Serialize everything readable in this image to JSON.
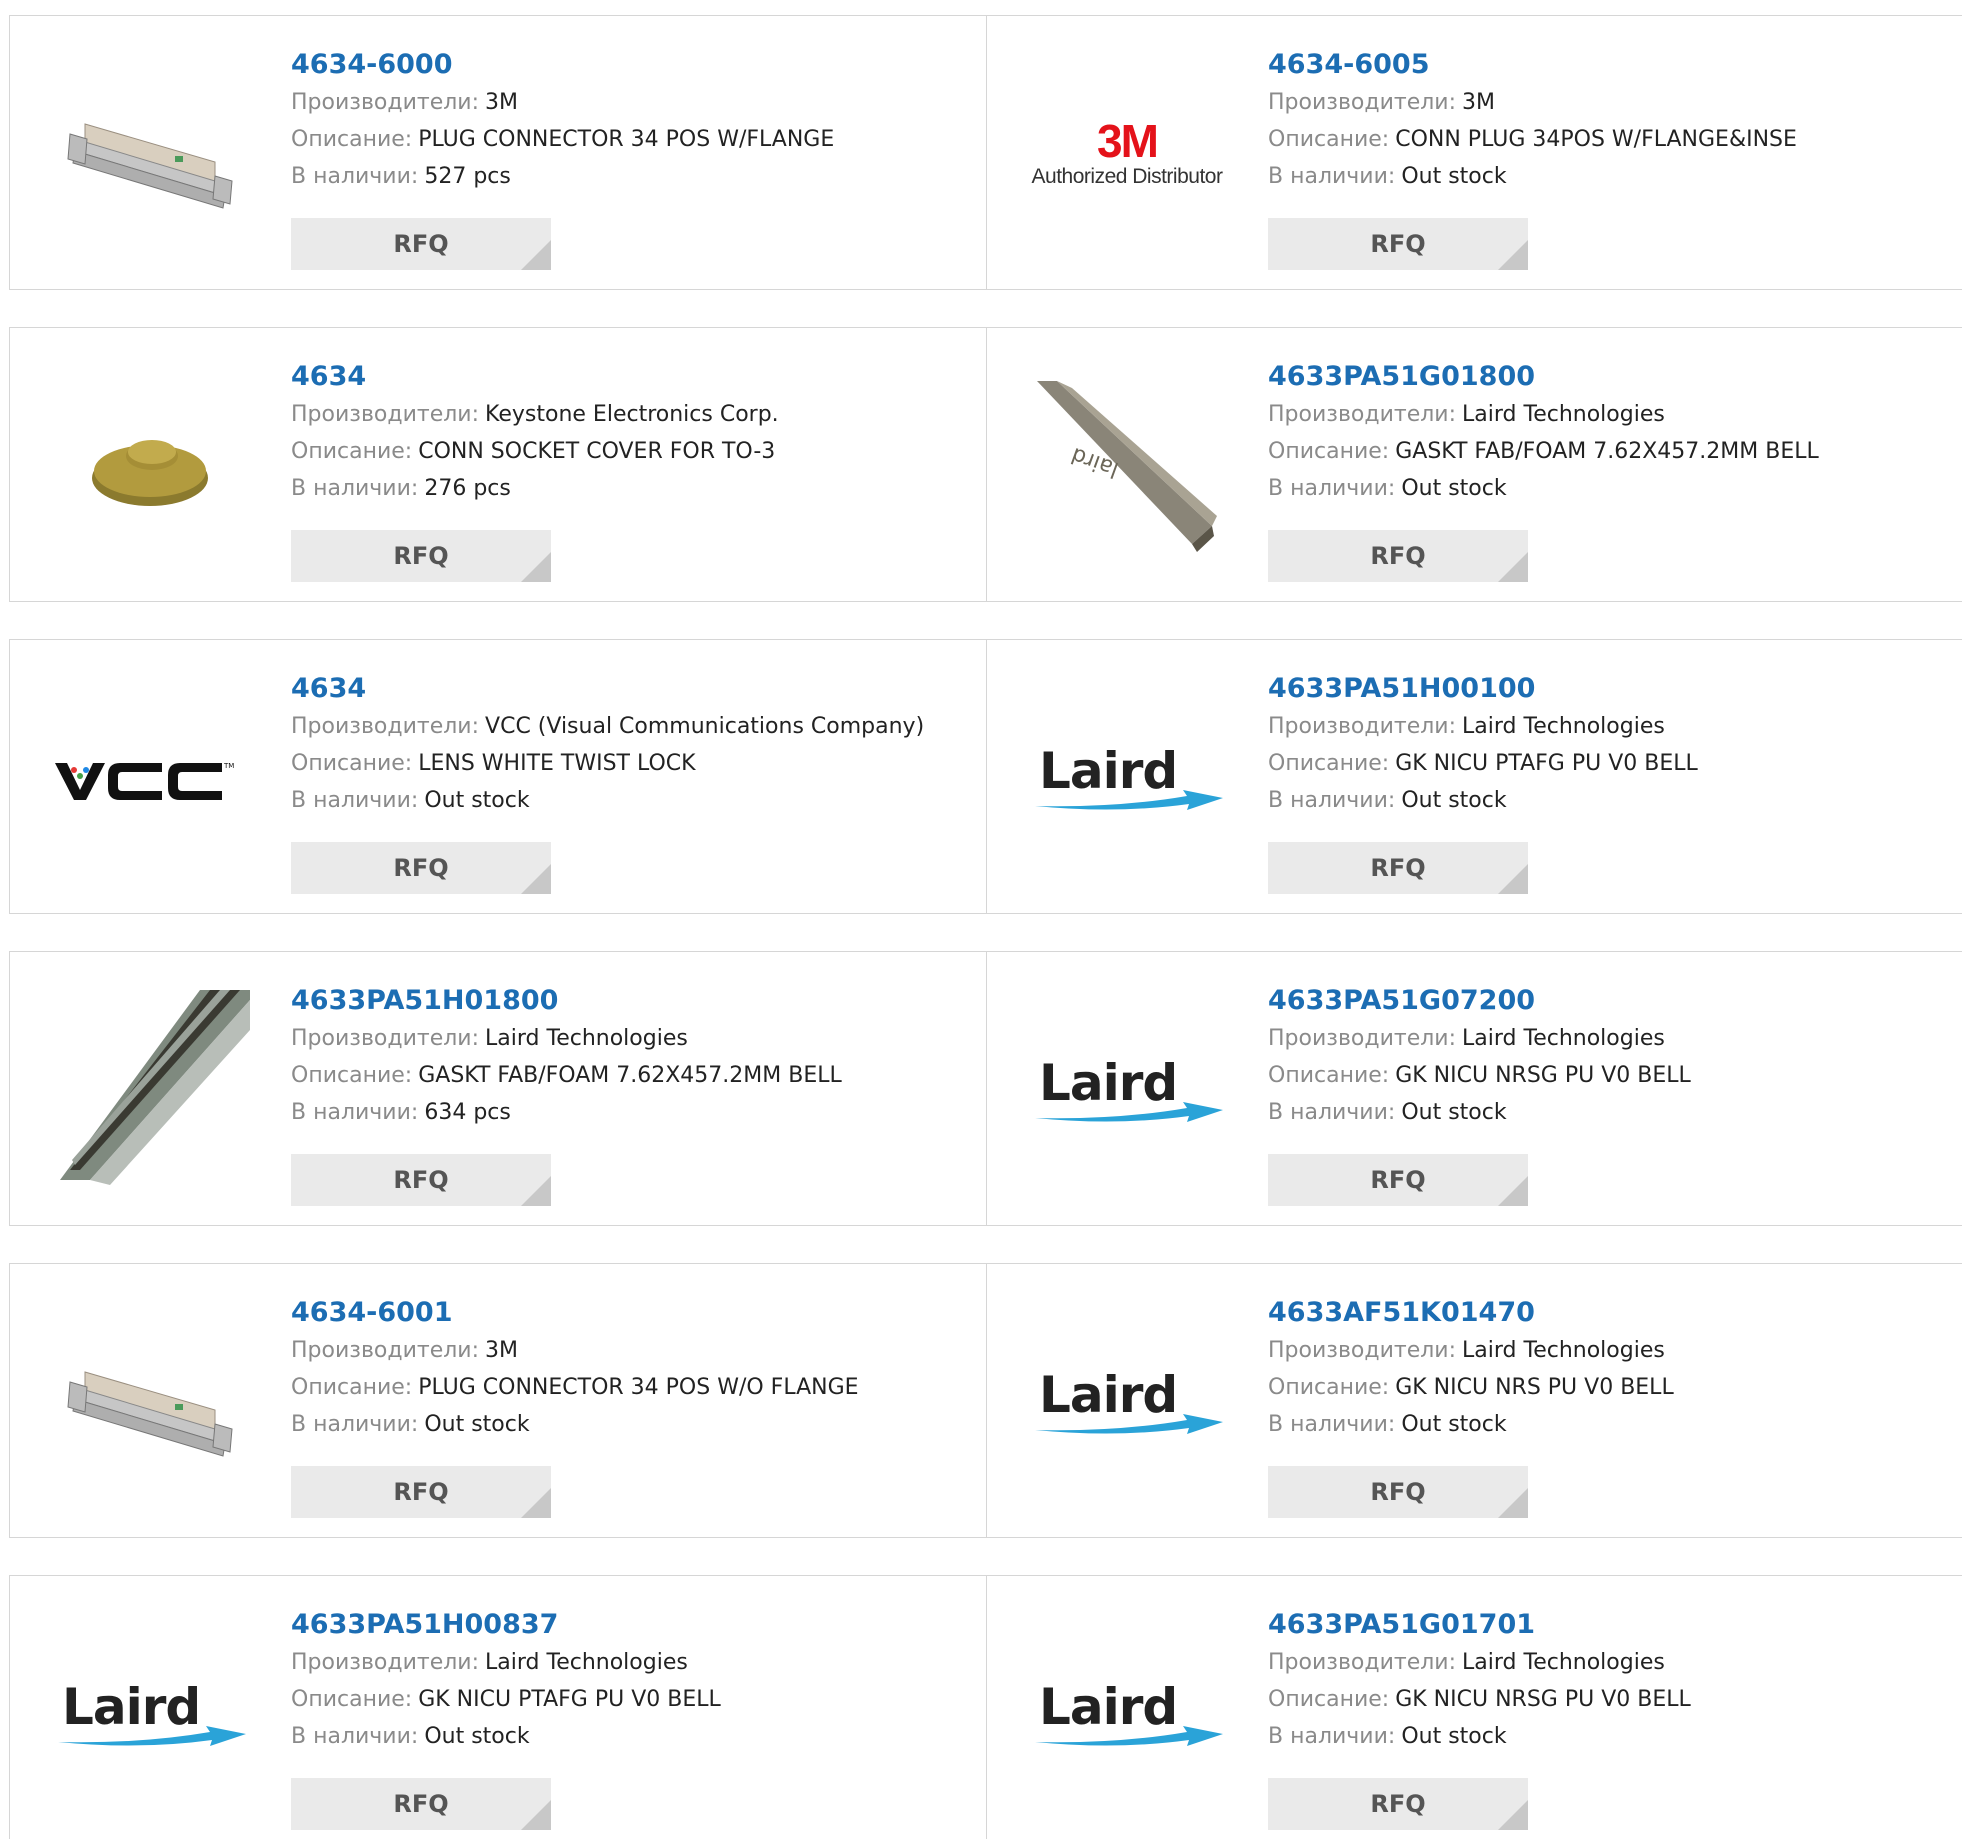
{
  "labels": {
    "manufacturer": "Производители:",
    "description": "Описание:",
    "stock": "В наличии:",
    "rfq": "RFQ"
  },
  "colors": {
    "part_link": "#1c6db3",
    "label_gray": "#8a8a8a",
    "rfq_bg": "#eaeaea",
    "border": "#d6d6d6"
  },
  "logos": {
    "three_m_big": "3M",
    "three_m_small": "Authorized Distributor",
    "laird": "Laird",
    "vcc": "VCC"
  },
  "products": [
    {
      "part": "4634-6000",
      "manufacturer": "3M",
      "description": "PLUG CONNECTOR 34 POS W/FLANGE",
      "stock": "527 pcs",
      "image": "ribbon-connector-photo"
    },
    {
      "part": "4634-6005",
      "manufacturer": "3M",
      "description": "CONN PLUG 34POS W/FLANGE&INSE",
      "stock": "Out stock",
      "image": "3m-authorized-logo"
    },
    {
      "part": "4634",
      "manufacturer": "Keystone Electronics Corp.",
      "description": "CONN SOCKET COVER FOR TO-3",
      "stock": "276 pcs",
      "image": "socket-cover-photo"
    },
    {
      "part": "4633PA51G01800",
      "manufacturer": "Laird Technologies",
      "description": "GASKT FAB/FOAM 7.62X457.2MM BELL",
      "stock": "Out stock",
      "image": "gasket-profile-photo"
    },
    {
      "part": "4634",
      "manufacturer": "VCC (Visual Communications Company)",
      "description": "LENS WHITE TWIST LOCK",
      "stock": "Out stock",
      "image": "vcc-logo"
    },
    {
      "part": "4633PA51H00100",
      "manufacturer": "Laird Technologies",
      "description": "GK NICU PTAFG PU V0 BELL",
      "stock": "Out stock",
      "image": "laird-logo"
    },
    {
      "part": "4633PA51H01800",
      "manufacturer": "Laird Technologies",
      "description": "GASKT FAB/FOAM 7.62X457.2MM BELL",
      "stock": "634 pcs",
      "image": "gasket-strip-photo"
    },
    {
      "part": "4633PA51G07200",
      "manufacturer": "Laird Technologies",
      "description": "GK NICU NRSG PU V0 BELL",
      "stock": "Out stock",
      "image": "laird-logo"
    },
    {
      "part": "4634-6001",
      "manufacturer": "3M",
      "description": "PLUG CONNECTOR 34 POS W/O FLANGE",
      "stock": "Out stock",
      "image": "ribbon-connector-photo-2"
    },
    {
      "part": "4633AF51K01470",
      "manufacturer": "Laird Technologies",
      "description": "GK NICU NRS PU V0 BELL",
      "stock": "Out stock",
      "image": "laird-logo"
    },
    {
      "part": "4633PA51H00837",
      "manufacturer": "Laird Technologies",
      "description": "GK NICU PTAFG PU V0 BELL",
      "stock": "Out stock",
      "image": "laird-logo"
    },
    {
      "part": "4633PA51G01701",
      "manufacturer": "Laird Technologies",
      "description": "GK NICU NRSG PU V0 BELL",
      "stock": "Out stock",
      "image": "laird-logo"
    }
  ]
}
